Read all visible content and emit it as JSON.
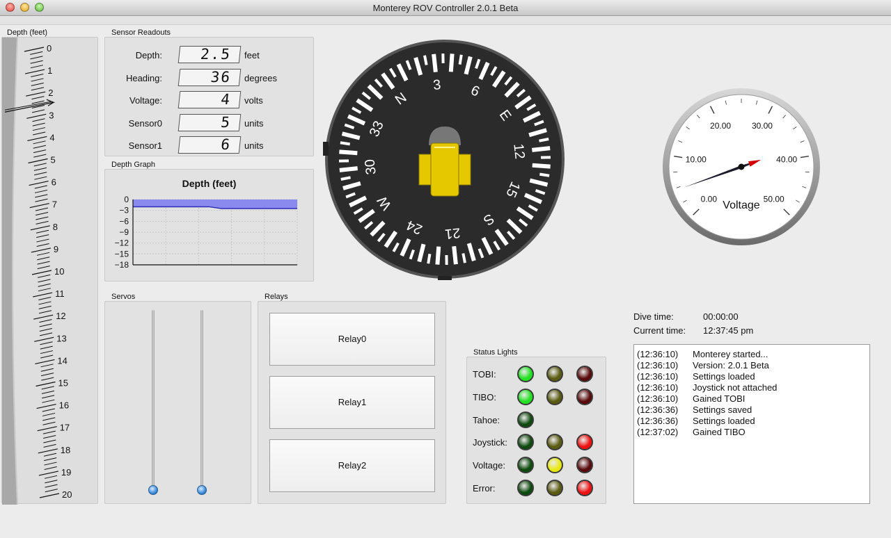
{
  "window": {
    "title": "Monterey ROV Controller 2.0.1 Beta"
  },
  "depth_gauge": {
    "label": "Depth (feet)",
    "ticks": [
      "0",
      "1",
      "2",
      "3",
      "4",
      "5",
      "6",
      "7",
      "8",
      "9",
      "10",
      "11",
      "12",
      "13",
      "14",
      "15",
      "16",
      "17",
      "18",
      "19",
      "20"
    ],
    "pointer_value": 2.5
  },
  "sensor_readouts": {
    "label": "Sensor Readouts",
    "rows": [
      {
        "name": "Depth:",
        "value": "2.5",
        "unit": "feet"
      },
      {
        "name": "Heading:",
        "value": "36",
        "unit": "degrees"
      },
      {
        "name": "Voltage:",
        "value": "4",
        "unit": "volts"
      },
      {
        "name": "Sensor0",
        "value": "5",
        "unit": "units"
      },
      {
        "name": "Sensor1",
        "value": "6",
        "unit": "units"
      }
    ]
  },
  "depth_graph": {
    "label": "Depth Graph",
    "title": "Depth (feet)",
    "y_ticks": [
      "0",
      "−3",
      "−6",
      "−9",
      "−12",
      "−15",
      "−18"
    ]
  },
  "chart_data": {
    "type": "area",
    "title": "Depth (feet)",
    "ylim": [
      -18,
      0
    ],
    "series": [
      {
        "values": [
          -2,
          -2,
          -2,
          -2,
          -2,
          -2,
          -2,
          -2.5,
          -2.5,
          -2.5,
          -2.5,
          -2.5,
          -2.5,
          -2.5
        ]
      }
    ],
    "grid": true
  },
  "compass": {
    "heading": 36,
    "labels": [
      "N",
      "3",
      "6",
      "E",
      "12",
      "15",
      "S",
      "21",
      "24",
      "W",
      "30",
      "33"
    ],
    "color_body": "#2b2b2b",
    "color_vehicle": "#e6c800"
  },
  "voltage_gauge": {
    "title": "Voltage",
    "ticks": [
      "0.00",
      "10.00",
      "20.00",
      "30.00",
      "40.00",
      "50.00"
    ],
    "value": 38,
    "min": 0,
    "max": 50,
    "needle_color": "#d40000"
  },
  "servos": {
    "label": "Servos",
    "values": [
      0,
      0
    ]
  },
  "relays": {
    "label": "Relays",
    "buttons": [
      "Relay0",
      "Relay1",
      "Relay2"
    ]
  },
  "status_lights": {
    "label": "Status Lights",
    "rows": [
      {
        "name": "TOBI:",
        "colors": [
          "#22e022",
          "#5a5a10",
          "#5a0a0a"
        ]
      },
      {
        "name": "TIBO:",
        "colors": [
          "#22e022",
          "#5a5a10",
          "#5a0a0a"
        ]
      },
      {
        "name": "Tahoe:",
        "colors": [
          "#0d4a0d"
        ]
      },
      {
        "name": "Joystick:",
        "colors": [
          "#0d4a0d",
          "#5a5a10",
          "#ee1111"
        ]
      },
      {
        "name": "Voltage:",
        "colors": [
          "#0d4a0d",
          "#e8e810",
          "#5a0a0a"
        ]
      },
      {
        "name": "Error:",
        "colors": [
          "#0d4a0d",
          "#5a5a10",
          "#ee1111"
        ]
      }
    ]
  },
  "times": {
    "dive_label": "Dive time:",
    "dive_value": "00:00:00",
    "current_label": "Current time:",
    "current_value": "12:37:45 pm"
  },
  "log": [
    {
      "time": "(12:36:10)",
      "msg": "Monterey started..."
    },
    {
      "time": "(12:36:10)",
      "msg": "Version: 2.0.1 Beta"
    },
    {
      "time": "(12:36:10)",
      "msg": "Settings loaded"
    },
    {
      "time": "(12:36:10)",
      "msg": "Joystick not attached"
    },
    {
      "time": "(12:36:10)",
      "msg": "Gained TOBI"
    },
    {
      "time": "(12:36:36)",
      "msg": "Settings saved"
    },
    {
      "time": "(12:36:36)",
      "msg": "Settings loaded"
    },
    {
      "time": "(12:37:02)",
      "msg": "Gained TIBO"
    }
  ]
}
